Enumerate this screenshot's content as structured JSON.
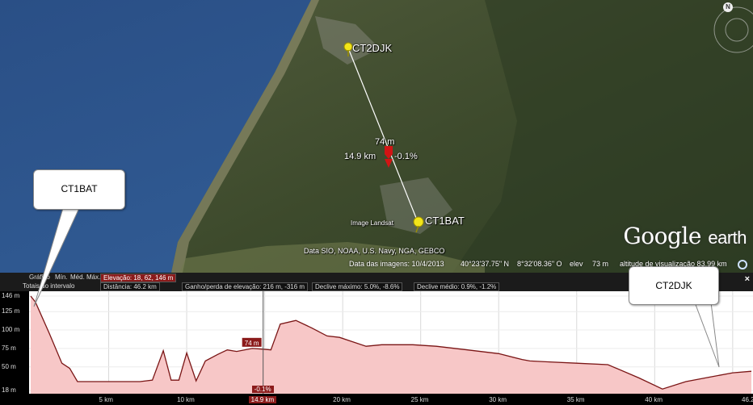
{
  "map": {
    "pin_top": {
      "label": "CT2DJK"
    },
    "pin_bottom": {
      "label": "CT1BAT"
    },
    "midpoint": {
      "elevation": "74 m",
      "distance": "14.9 km",
      "slope": "-0.1%"
    },
    "credit_landsat": "Image Landsat",
    "credit_data": "Data SIO, NOAA, U.S. Navy, NGA, GEBCO",
    "compass_n": "N",
    "logo_google": "Google",
    "logo_earth": "earth",
    "status": {
      "date": "Data das imagens: 10/4/2013",
      "lat": "40°23'37.75\" N",
      "lon": "8°32'08.36\" O",
      "elev_label": "elev",
      "elev": "73 m",
      "altitude": "altitude de visualização  83.99 km"
    }
  },
  "profile": {
    "header": {
      "row1_prefix": "Gráfico",
      "min_label": "Mín.",
      "med_label": "Méd.",
      "max_label": "Máx.",
      "elevation": "Elevação: 18, 62, 146 m",
      "row2_prefix": "Totais do intervalo",
      "distance": "Distância: 46.2 km",
      "gain_loss": "Ganho/perda de elevação: 216 m, -316 m",
      "max_slope": "Declive máximo: 5.0%, -8.6%",
      "avg_slope": "Declive médio: 0.9%, -1.2%"
    },
    "close_label": "×",
    "y_ticks": [
      "146 m",
      "125 m",
      "100 m",
      "75 m",
      "50 m",
      "18 m"
    ],
    "x_ticks": [
      "5 km",
      "10 km",
      "15 km",
      "20 km",
      "25 km",
      "30 km",
      "35 km",
      "40 km",
      "46.2 km"
    ],
    "cursor_x_label": "14.9 km",
    "cursor_elev_label": "74 m",
    "cursor_slope_label": "-0.1%",
    "chart_data": {
      "type": "area",
      "xlabel": "",
      "ylabel": "",
      "xlim": [
        0,
        46.2
      ],
      "ylim": [
        18,
        146
      ],
      "grid": true,
      "x": [
        0,
        0.3,
        1.2,
        2,
        2.5,
        3,
        3.8,
        5,
        6,
        7,
        7.8,
        8.5,
        9,
        9.5,
        10,
        10.6,
        11.2,
        12,
        12.6,
        13.2,
        14.2,
        14.9,
        15.4,
        16,
        17,
        18,
        19,
        19.8,
        20.5,
        21.5,
        22.5,
        23.5,
        24.5,
        26,
        28,
        30,
        31.5,
        32,
        33,
        35,
        37,
        39,
        40.5,
        42,
        43.5,
        45,
        46.2
      ],
      "y": [
        146,
        138,
        95,
        55,
        48,
        30,
        30,
        30,
        30,
        30,
        32,
        72,
        32,
        32,
        69,
        31,
        58,
        67,
        73,
        71,
        75,
        74,
        73,
        108,
        113,
        103,
        92,
        90,
        85,
        78,
        80,
        80,
        80,
        78,
        73,
        68,
        60,
        58,
        57,
        55,
        53,
        35,
        20,
        30,
        36,
        42,
        44
      ]
    }
  },
  "callouts": {
    "left": "CT1BAT",
    "right": "CT2DJK"
  }
}
